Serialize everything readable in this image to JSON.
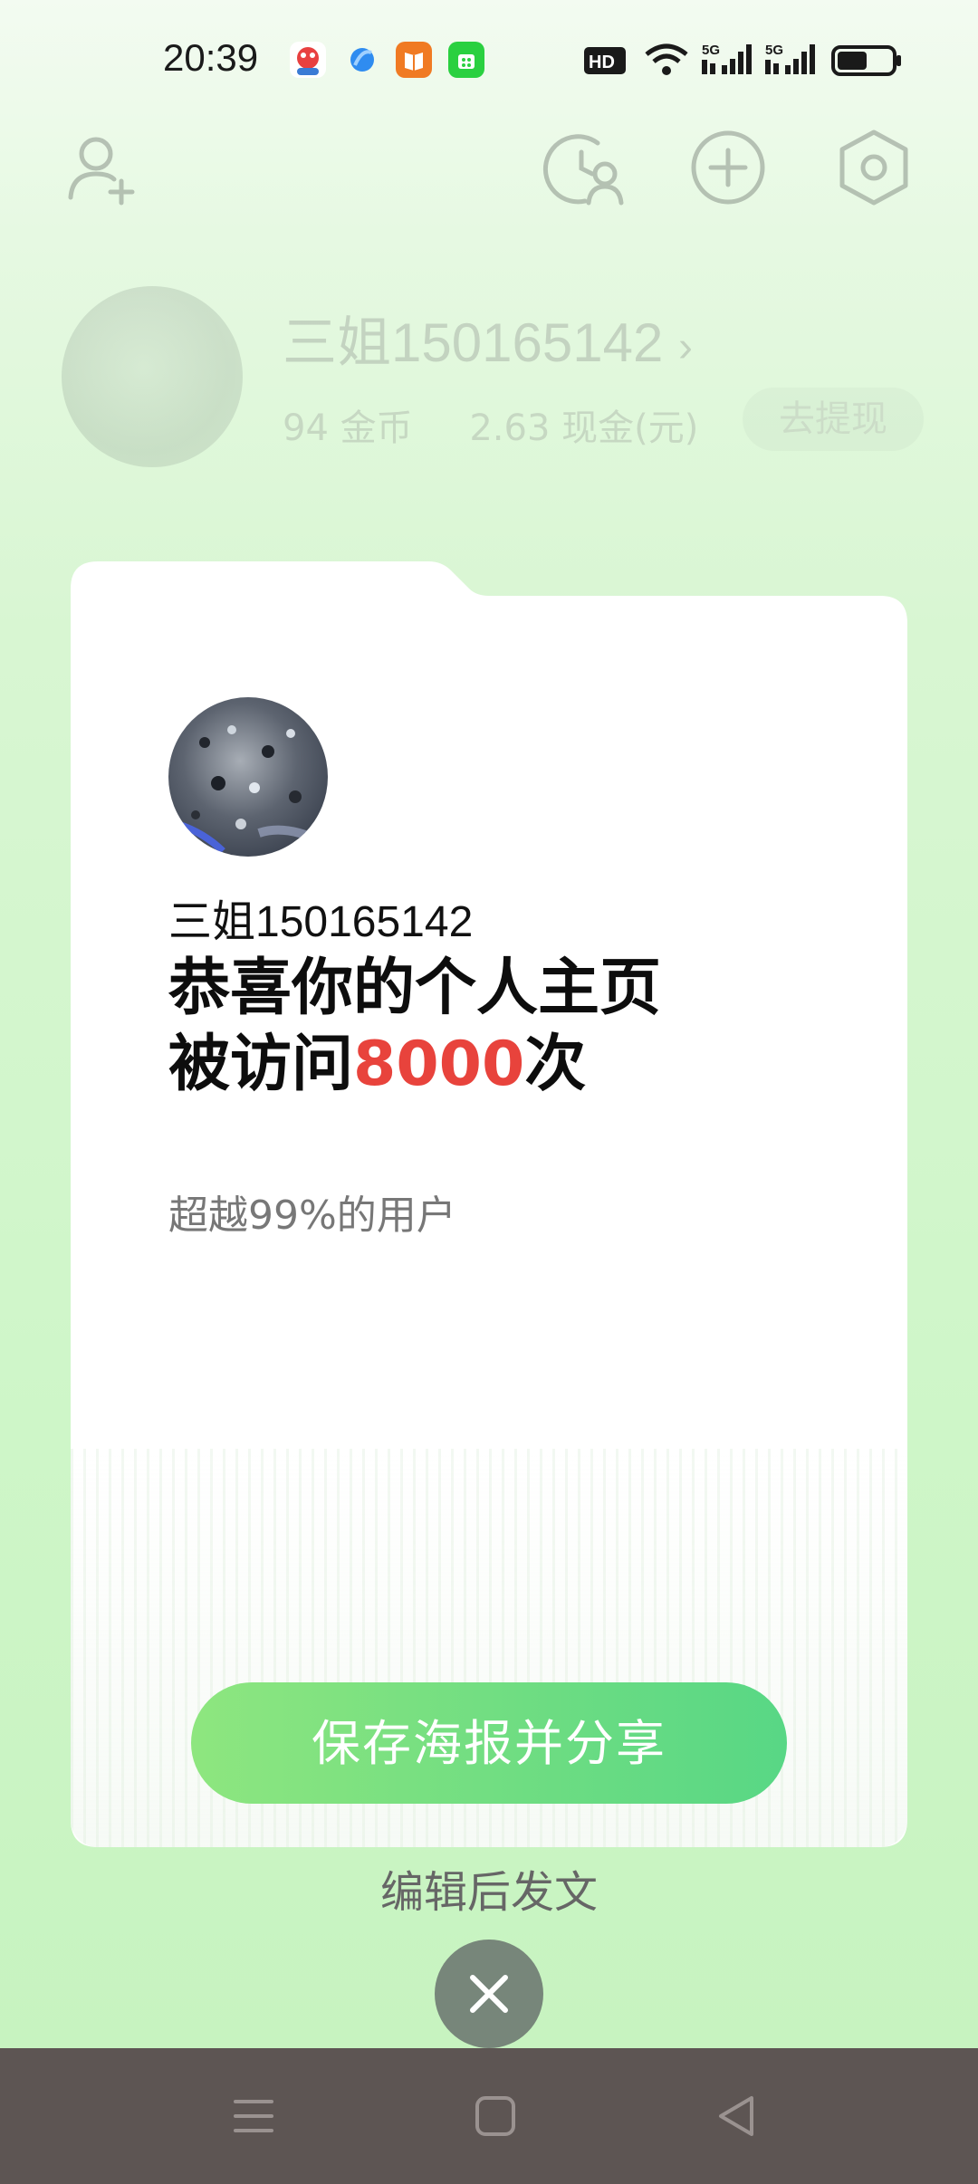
{
  "status_bar": {
    "time": "20:39",
    "icons": [
      "douyin-app-icon",
      "browser-app-icon",
      "books-app-icon",
      "store-app-icon",
      "hd-icon",
      "wifi-icon",
      "signal-5g-icon",
      "signal-5g-icon",
      "battery-icon"
    ],
    "battery_level": 0.55
  },
  "header": {
    "icons": [
      "add-friend-icon",
      "visitor-history-icon",
      "add-icon",
      "settings-icon"
    ]
  },
  "profile": {
    "username": "三姐150165142",
    "coins": "94 金币",
    "cash": "2.63 现金(元)",
    "withdraw_label": "去提现"
  },
  "poster": {
    "username": "三姐150165142",
    "headline_line1": "恭喜你的个人主页",
    "headline_prefix": "被访问",
    "headline_count": "8000",
    "headline_suffix": "次",
    "subtext": "超越99%的用户",
    "button_label": "保存海报并分享",
    "accent_color": "#e8433c",
    "button_color": "#6fdd82"
  },
  "edit_link_label": "编辑后发文",
  "nav": {
    "icons": [
      "menu-icon",
      "home-icon",
      "back-icon"
    ]
  }
}
